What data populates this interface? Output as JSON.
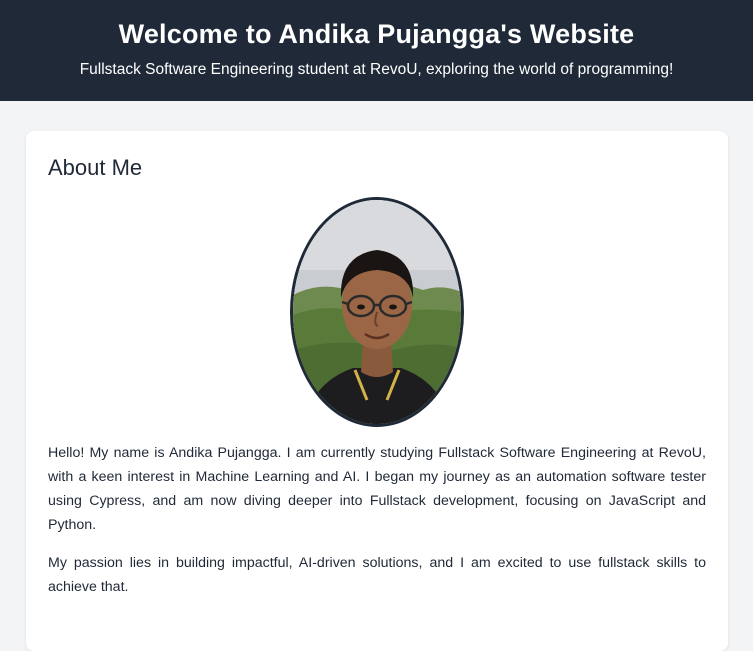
{
  "header": {
    "title": "Welcome to Andika Pujangga's Website",
    "subtitle": "Fullstack Software Engineering student at RevoU, exploring the world of programming!"
  },
  "about": {
    "heading": "About Me",
    "photo_alt": "Andika Pujangga",
    "paragraphs": [
      "Hello! My name is Andika Pujangga. I am currently studying Fullstack Software Engineering at RevoU, with a keen interest in Machine Learning and AI. I began my journey as an automation software tester using Cypress, and am now diving deeper into Fullstack development, focusing on JavaScript and Python.",
      "My passion lies in building impactful, AI-driven solutions, and I am excited to use fullstack skills to achieve that."
    ]
  },
  "colors": {
    "header_bg": "#1f2937",
    "page_bg": "#f3f4f6",
    "card_bg": "#ffffff",
    "text": "#1f2937"
  }
}
